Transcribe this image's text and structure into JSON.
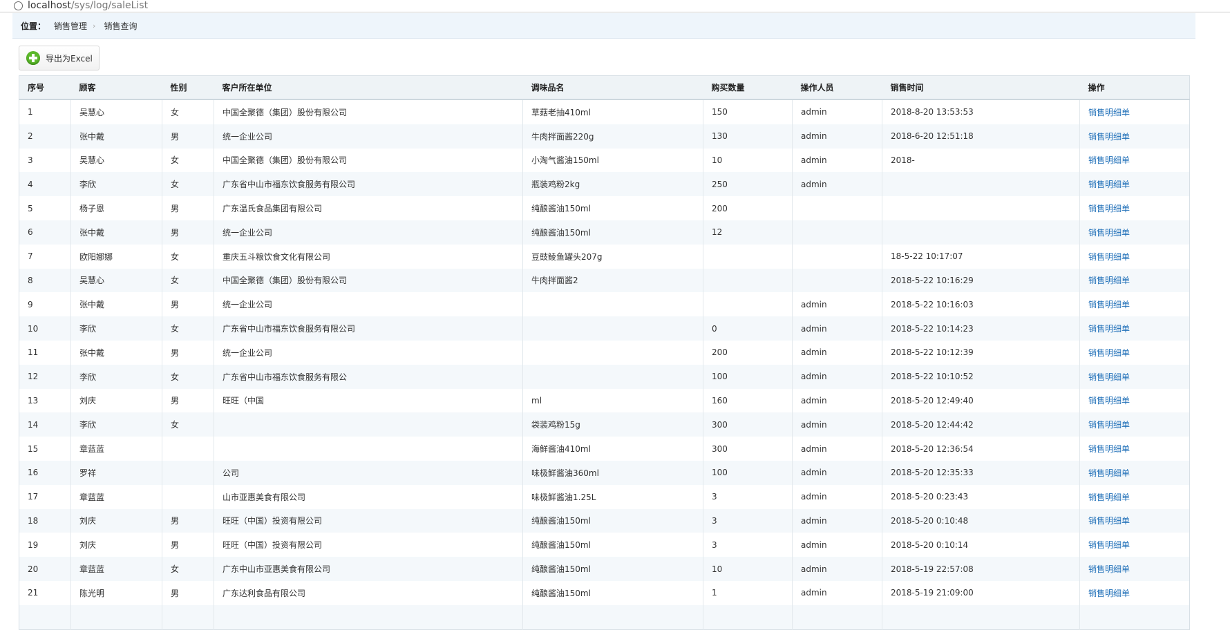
{
  "browser": {
    "url_host": "localhost",
    "url_path": "/sys/log/saleList"
  },
  "breadcrumb": {
    "label": "位置：",
    "items": [
      "销售管理",
      "销售查询"
    ],
    "separator": "›"
  },
  "toolbar": {
    "export_label": "导出为Excel",
    "export_icon": "plus-circle-icon",
    "accent": "#5cb82b"
  },
  "table": {
    "headers": [
      "序号",
      "顾客",
      "性别",
      "客户所在单位",
      "调味品名",
      "购买数量",
      "操作人员",
      "销售时间",
      "操作"
    ],
    "link_color": "#1f6fb8",
    "rows": [
      [
        "1",
        "吴慧心",
        "女",
        "中国全聚德（集团）股份有限公司",
        "草菇老抽410ml",
        "150",
        "admin",
        "2018-8-20 13:53:53",
        "销售明细单"
      ],
      [
        "2",
        "张中戴",
        "男",
        "统一企业公司",
        "牛肉拌面酱220g",
        "130",
        "admin",
        "2018-6-20 12:51:18",
        "销售明细单"
      ],
      [
        "3",
        "吴慧心",
        "女",
        "中国全聚德（集团）股份有限公司",
        "小淘气酱油150ml",
        "10",
        "admin",
        "2018-",
        "销售明细单"
      ],
      [
        "4",
        "李欣",
        "女",
        "广东省中山市福东饮食服务有限公司",
        "瓶装鸡粉2kg",
        "250",
        "admin",
        "",
        "销售明细单"
      ],
      [
        "5",
        "杨子恩",
        "男",
        "广东温氏食品集团有限公司",
        "纯酿酱油150ml",
        "200",
        "",
        "",
        "销售明细单"
      ],
      [
        "6",
        "张中戴",
        "男",
        "统一企业公司",
        "纯酿酱油150ml",
        "12",
        "",
        "",
        "销售明细单"
      ],
      [
        "7",
        "欧阳娜娜",
        "女",
        "重庆五斗粮饮食文化有限公司",
        "豆豉鲮鱼罐头207g",
        "",
        "",
        "18-5-22 10:17:07",
        "销售明细单"
      ],
      [
        "8",
        "吴慧心",
        "女",
        "中国全聚德（集团）股份有限公司",
        "牛肉拌面酱2",
        "",
        "",
        "2018-5-22 10:16:29",
        "销售明细单"
      ],
      [
        "9",
        "张中戴",
        "男",
        "统一企业公司",
        "",
        "",
        "admin",
        "2018-5-22 10:16:03",
        "销售明细单"
      ],
      [
        "10",
        "李欣",
        "女",
        "广东省中山市福东饮食服务有限公司",
        "",
        "0",
        "admin",
        "2018-5-22 10:14:23",
        "销售明细单"
      ],
      [
        "11",
        "张中戴",
        "男",
        "统一企业公司",
        "",
        "200",
        "admin",
        "2018-5-22 10:12:39",
        "销售明细单"
      ],
      [
        "12",
        "李欣",
        "女",
        "广东省中山市福东饮食服务有限公",
        "",
        "100",
        "admin",
        "2018-5-22 10:10:52",
        "销售明细单"
      ],
      [
        "13",
        "刘庆",
        "男",
        "旺旺（中国",
        "ml",
        "160",
        "admin",
        "2018-5-20 12:49:40",
        "销售明细单"
      ],
      [
        "14",
        "李欣",
        "女",
        "",
        "袋装鸡粉15g",
        "300",
        "admin",
        "2018-5-20 12:44:42",
        "销售明细单"
      ],
      [
        "15",
        "章蓝蓝",
        "",
        "",
        "海鲜酱油410ml",
        "300",
        "admin",
        "2018-5-20 12:36:54",
        "销售明细单"
      ],
      [
        "16",
        "罗祥",
        "",
        "公司",
        "味极鲜酱油360ml",
        "100",
        "admin",
        "2018-5-20 12:35:33",
        "销售明细单"
      ],
      [
        "17",
        "章蓝蓝",
        "",
        "山市亚惠美食有限公司",
        "味极鲜酱油1.25L",
        "3",
        "admin",
        "2018-5-20 0:23:43",
        "销售明细单"
      ],
      [
        "18",
        "刘庆",
        "男",
        "旺旺（中国）投资有限公司",
        "纯酿酱油150ml",
        "3",
        "admin",
        "2018-5-20 0:10:48",
        "销售明细单"
      ],
      [
        "19",
        "刘庆",
        "男",
        "旺旺（中国）投资有限公司",
        "纯酿酱油150ml",
        "3",
        "admin",
        "2018-5-20 0:10:14",
        "销售明细单"
      ],
      [
        "20",
        "章蓝蓝",
        "女",
        "广东中山市亚惠美食有限公司",
        "纯酿酱油150ml",
        "10",
        "admin",
        "2018-5-19 22:57:08",
        "销售明细单"
      ],
      [
        "21",
        "陈光明",
        "男",
        "广东达利食品有限公司",
        "纯酿酱油150ml",
        "1",
        "admin",
        "2018-5-19 21:09:00",
        "销售明细单"
      ],
      [
        "",
        "",
        "",
        "",
        "",
        "",
        "",
        "",
        ""
      ]
    ]
  }
}
